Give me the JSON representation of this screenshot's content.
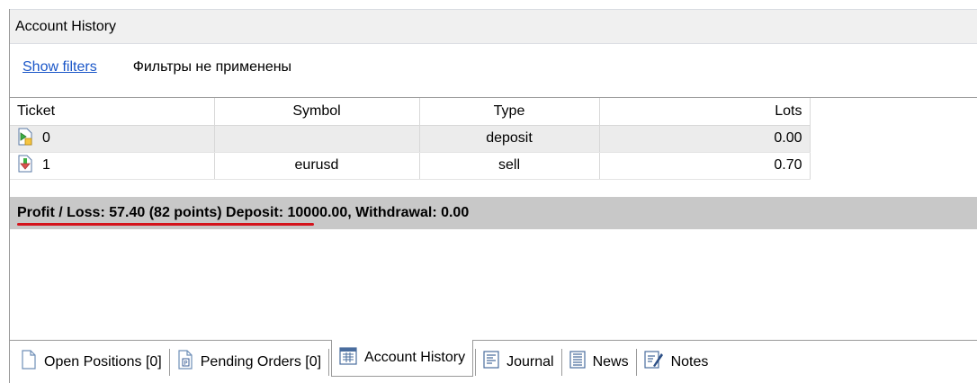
{
  "window": {
    "title": "Account History"
  },
  "filters": {
    "show_label": "Show filters",
    "status_text": "Фильтры не применены"
  },
  "table": {
    "columns": {
      "ticket": "Ticket",
      "symbol": "Symbol",
      "type": "Type",
      "lots": "Lots"
    },
    "rows": [
      {
        "ticket": "0",
        "symbol": "",
        "type": "deposit",
        "lots": "0.00",
        "icon": "deposit-icon"
      },
      {
        "ticket": "1",
        "symbol": "eurusd",
        "type": "sell",
        "lots": "0.70",
        "icon": "sell-arrow-icon"
      }
    ]
  },
  "summary": {
    "text": "Profit / Loss: 57.40 (82 points) Deposit: 10000.00, Withdrawal: 0.00"
  },
  "tabs": [
    {
      "label": "Open Positions [0]",
      "icon": "document-icon"
    },
    {
      "label": "Pending Orders [0]",
      "icon": "pending-document-icon"
    },
    {
      "label": "Account History",
      "icon": "history-table-icon",
      "active": true
    },
    {
      "label": "Journal",
      "icon": "journal-icon"
    },
    {
      "label": "News",
      "icon": "news-icon"
    },
    {
      "label": "Notes",
      "icon": "notes-pen-icon"
    }
  ],
  "colors": {
    "link": "#1a56c8",
    "summary_bg": "#c8c8c8",
    "highlight": "#d4131b"
  }
}
